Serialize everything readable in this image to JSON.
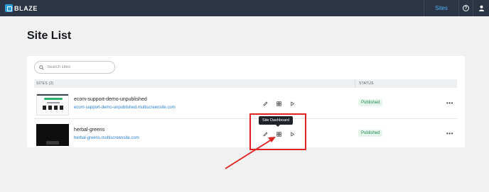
{
  "header": {
    "brand": "BLAZE",
    "nav_sites": "Sites",
    "help_glyph": "?",
    "user_icon": "user-icon",
    "colors": {
      "bar": "#2b3545",
      "accent": "#4fb3f4"
    }
  },
  "page": {
    "title": "Site List"
  },
  "search": {
    "placeholder": "Search sites",
    "value": ""
  },
  "table": {
    "col_sites": "SITES (2)",
    "col_status": "STATUS",
    "rows": [
      {
        "name": "ecom-support-demo-unpublished",
        "url": "ecom-support-demo-unpublished.multiscreensite.com",
        "status": "Published",
        "more": "•••"
      },
      {
        "name": "herbal-greens",
        "url": "herbal-greens.multiscreensite.com",
        "status": "Published",
        "more": "•••"
      }
    ]
  },
  "tooltip": {
    "text": "Site Dashboard"
  },
  "colors": {
    "published_bg": "#e6f6ec",
    "published_text": "#1f8a4c",
    "annotation": "#e02424",
    "link": "#2a7fd4"
  }
}
